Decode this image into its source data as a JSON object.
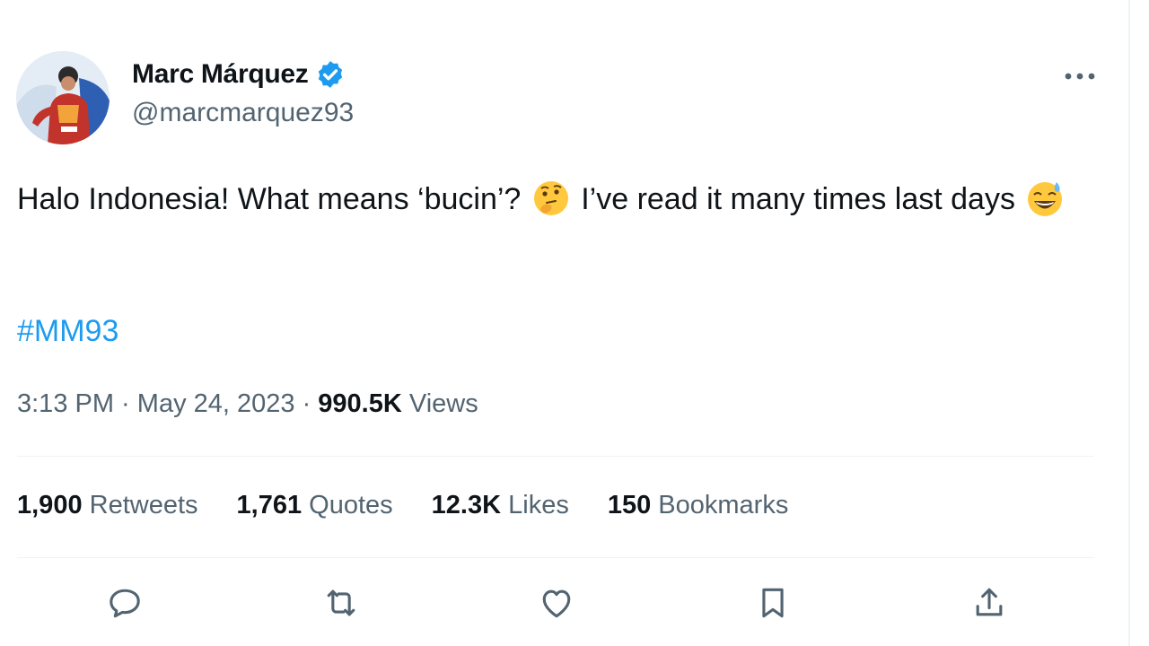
{
  "author": {
    "name": "Marc Márquez",
    "handle": "@marcmarquez93",
    "avatar_icon": "profile-photo-rider"
  },
  "tweet": {
    "text_part1": "Halo Indonesia! What means ‘bucin’? ",
    "emoji1": "thinking-face-emoji",
    "text_part2": " I’ve read it many times last days ",
    "emoji2": "grinning-sweat-emoji",
    "hashtag": "#MM93"
  },
  "meta": {
    "time": "3:13 PM",
    "separator": " · ",
    "date": "May 24, 2023",
    "views_count": "990.5K",
    "views_label": " Views"
  },
  "stats": {
    "retweets_count": "1,900",
    "retweets_label": " Retweets",
    "quotes_count": "1,761",
    "quotes_label": " Quotes",
    "likes_count": "12.3K",
    "likes_label": " Likes",
    "bookmarks_count": "150",
    "bookmarks_label": " Bookmarks"
  },
  "actions": [
    "reply-icon",
    "retweet-icon",
    "like-icon",
    "bookmark-icon",
    "share-icon"
  ],
  "colors": {
    "link": "#1d9bf0",
    "verified": "#1d9bf0",
    "secondary_text": "#536471",
    "primary_text": "#0f1419"
  }
}
